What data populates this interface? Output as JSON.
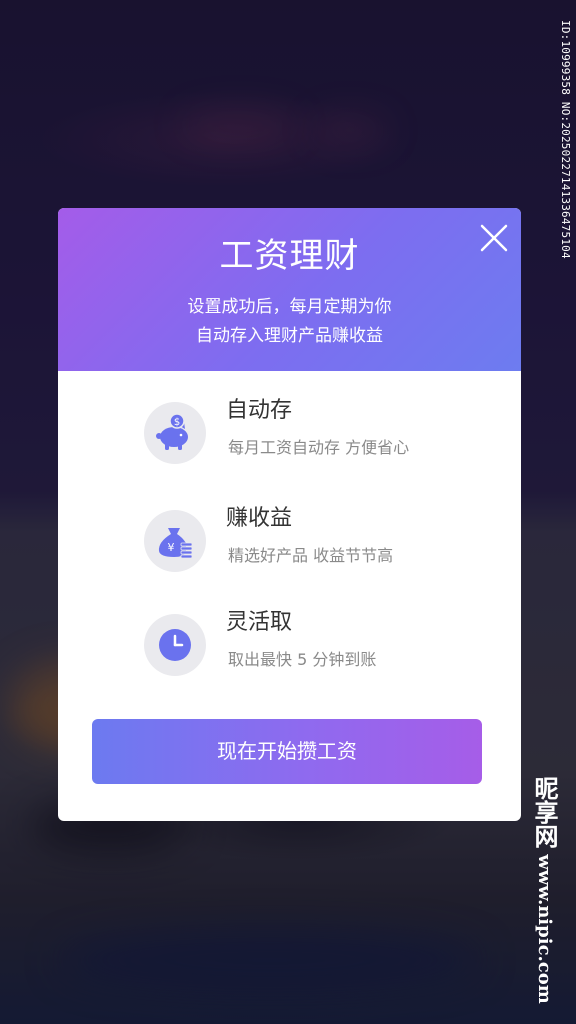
{
  "watermark": {
    "id_text": "ID:10999358 NO:20250227141336475104",
    "site_text": "www.nipic.com",
    "site_cn": "昵享网"
  },
  "modal": {
    "title": "工资理财",
    "subtitle_line1": "设置成功后，每月定期为你",
    "subtitle_line2": "自动存入理财产品赚收益",
    "features": [
      {
        "title": "自动存",
        "desc": "每月工资自动存 方便省心",
        "icon": "piggy-bank-icon"
      },
      {
        "title": "赚收益",
        "desc": "精选好产品 收益节节高",
        "icon": "money-bag-icon"
      },
      {
        "title": "灵活取",
        "desc": "取出最快 5 分钟到账",
        "icon": "clock-icon"
      }
    ],
    "cta_label": "现在开始攒工资"
  },
  "colors": {
    "header_gradient_start": "#a45ce9",
    "header_gradient_end": "#6d7cf0",
    "icon_accent": "#6a72ee",
    "icon_bg": "#eaeaee"
  }
}
